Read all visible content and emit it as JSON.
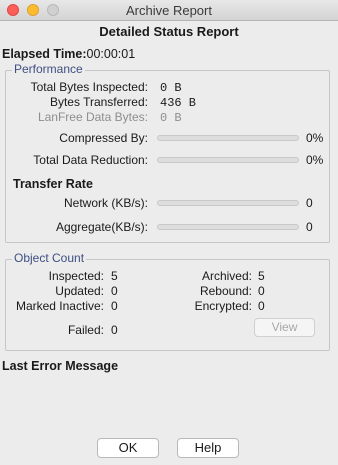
{
  "window": {
    "title": "Archive Report"
  },
  "report": {
    "heading": "Detailed Status Report",
    "elapsed_label": "Elapsed Time:",
    "elapsed_value": "00:00:01"
  },
  "performance": {
    "group_title": "Performance",
    "total_bytes_inspected_label": "Total Bytes Inspected:",
    "total_bytes_inspected_value": "0 B",
    "bytes_transferred_label": "Bytes Transferred:",
    "bytes_transferred_value": "436 B",
    "lanfree_label": "LanFree Data Bytes:",
    "lanfree_value": "0 B",
    "compressed_by_label": "Compressed By:",
    "compressed_by_value": "0%",
    "compressed_by_fraction": 0,
    "total_reduction_label": "Total Data Reduction:",
    "total_reduction_value": "0%",
    "total_reduction_fraction": 0,
    "transfer_rate_heading": "Transfer Rate",
    "network_label": "Network (KB/s):",
    "network_value": "0",
    "network_fraction": 0,
    "aggregate_label": "Aggregate(KB/s):",
    "aggregate_value": "0",
    "aggregate_fraction": 0
  },
  "object_count": {
    "group_title": "Object Count",
    "inspected_label": "Inspected:",
    "inspected_value": "5",
    "archived_label": "Archived:",
    "archived_value": "5",
    "updated_label": "Updated:",
    "updated_value": "0",
    "rebound_label": "Rebound:",
    "rebound_value": "0",
    "marked_inactive_label": "Marked Inactive:",
    "marked_inactive_value": "0",
    "encrypted_label": "Encrypted:",
    "encrypted_value": "0",
    "failed_label": "Failed:",
    "failed_value": "0",
    "view_button": "View"
  },
  "last_error": {
    "heading": "Last Error Message"
  },
  "footer": {
    "ok_button": "OK",
    "help_button": "Help"
  }
}
